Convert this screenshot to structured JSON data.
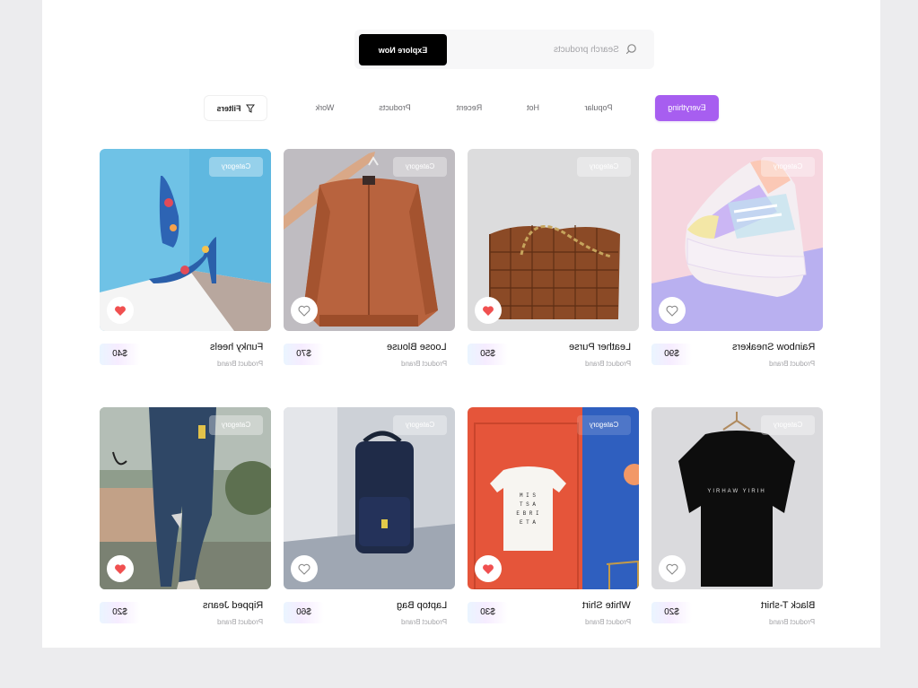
{
  "search": {
    "button_label": "Explore Now",
    "placeholder": "Search products"
  },
  "tabs": {
    "filters_label": "Filters",
    "items": [
      "Work",
      "Products",
      "Recent",
      "Hot",
      "Popular",
      "Everything"
    ],
    "active": "Everything"
  },
  "colors": {
    "accent": "#a75ef0",
    "heart_red": "#f05050"
  },
  "products": [
    {
      "name": "Rainbow Sneakers",
      "brand": "Product Brand",
      "price": "$90",
      "category": "Category",
      "liked": false
    },
    {
      "name": "Leather Purse",
      "brand": "Product Brand",
      "price": "$50",
      "category": "Category",
      "liked": true
    },
    {
      "name": "Loose Blouse",
      "brand": "Product Brand",
      "price": "$70",
      "category": "Category",
      "liked": false
    },
    {
      "name": "Funky heels",
      "brand": "Product Brand",
      "price": "$40",
      "category": "Category",
      "liked": true
    },
    {
      "name": "Black T-shirt",
      "brand": "Product Brand",
      "price": "$20",
      "category": "Category",
      "liked": false
    },
    {
      "name": "White Shirt",
      "brand": "Product Brand",
      "price": "$30",
      "category": "Category",
      "liked": true
    },
    {
      "name": "Laptop Bag",
      "brand": "Product Brand",
      "price": "$60",
      "category": "Category",
      "liked": false
    },
    {
      "name": "Ripped Jeans",
      "brand": "Product Brand",
      "price": "$20",
      "category": "Category",
      "liked": true
    }
  ],
  "icons": {
    "search": "search-icon",
    "filter": "filter-icon",
    "heart": "heart-icon"
  }
}
